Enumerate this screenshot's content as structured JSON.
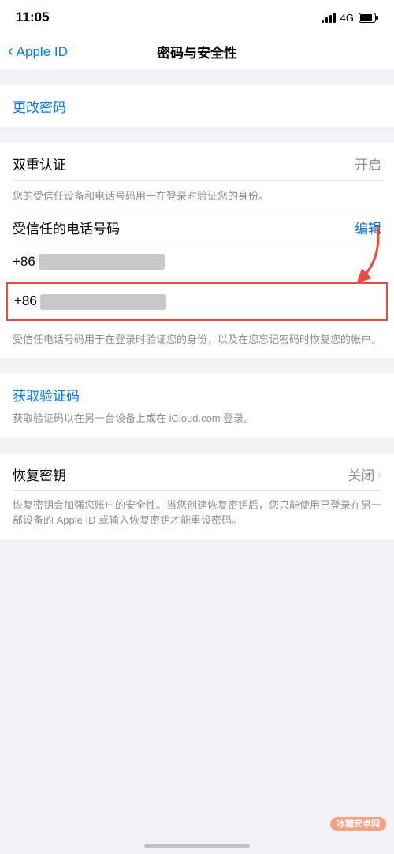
{
  "statusBar": {
    "time": "11:05",
    "signal": "4G",
    "batteryLevel": 75
  },
  "navBar": {
    "backLabel": "Apple ID",
    "title": "密码与安全性"
  },
  "sections": {
    "changePassword": {
      "label": "更改密码"
    },
    "twoFactor": {
      "title": "双重认证",
      "status": "开启",
      "description": "您的受信任设备和电话号码用于在登录时验证您的身份。",
      "trustedPhoneLabel": "受信任的电话号码",
      "editLabel": "编辑",
      "phone1": "+86",
      "phone2": "+86",
      "phoneFooterDesc": "受信任电话号码用于在登录时验证您的身份，以及在您忘记密码时恢复您的帐户。"
    },
    "getVerifyCode": {
      "label": "获取验证码",
      "description": "获取验证码以在另一台设备上或在 iCloud.com 登录。"
    },
    "recoveryKey": {
      "title": "恢复密钥",
      "status": "关闭",
      "description": "恢复密钥会加强您账户的安全性。当您创建恢复密钥后，您只能使用已登录在另一部设备的 Apple ID 或输入恢复密钥才能重设密码。"
    }
  },
  "watermark": {
    "text": "冰糖安卓网"
  }
}
